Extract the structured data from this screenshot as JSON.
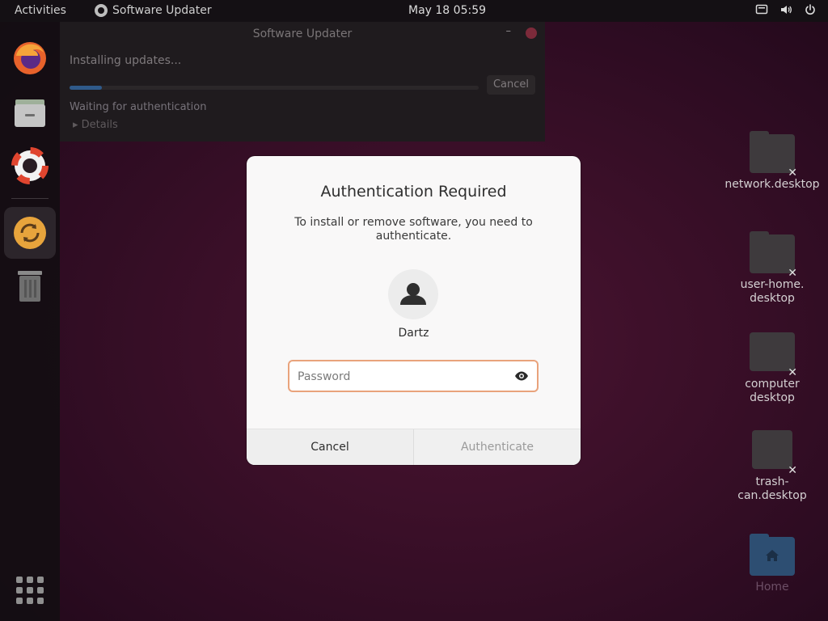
{
  "topbar": {
    "activities": "Activities",
    "app_name": "Software Updater",
    "clock": "May 18  05:59"
  },
  "dock": {
    "items": [
      "firefox",
      "files",
      "help",
      "software-updater",
      "trash"
    ]
  },
  "updater_window": {
    "title": "Software Updater",
    "status": "Installing updates...",
    "progress": 0.08,
    "cancel_label": "Cancel",
    "waiting": "Waiting for authentication",
    "details": "▸ Details"
  },
  "desktop_icons": [
    {
      "label": "network.desktop"
    },
    {
      "label": "user-home.\ndesktop"
    },
    {
      "label": "computer\ndesktop"
    },
    {
      "label": "trash-can.desktop"
    },
    {
      "label": "Home"
    }
  ],
  "auth_dialog": {
    "title": "Authentication Required",
    "message": "To install or remove software, you need to authenticate.",
    "username": "Dartz",
    "password_placeholder": "Password",
    "cancel_label": "Cancel",
    "authenticate_label": "Authenticate"
  },
  "colors": {
    "focus_border": "#e9a37c",
    "dialog_bg": "#f9f8f8",
    "desktop_bg": "#3a0f28"
  }
}
